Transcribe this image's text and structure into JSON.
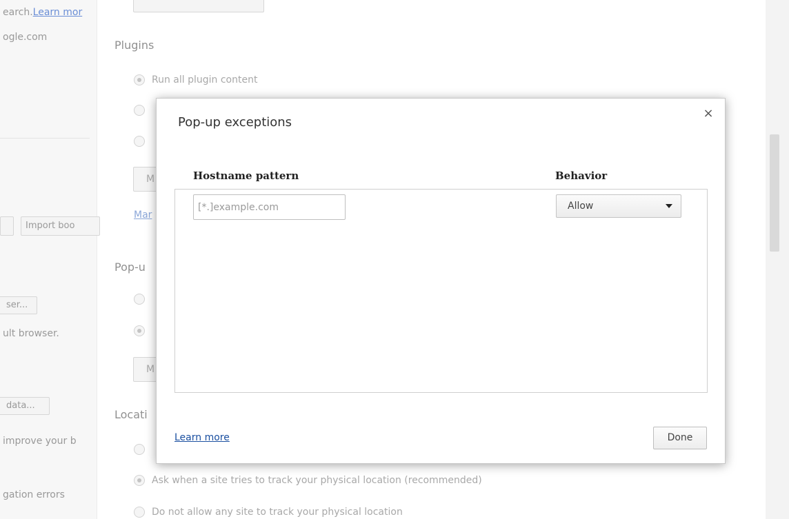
{
  "background": {
    "left_panel": {
      "t1": "earch.",
      "t1_link": "Learn mor",
      "t2": "ogle.com",
      "import_button": "Import boo",
      "btn2": "ser...",
      "t3": "ult browser.",
      "data_button": "data...",
      "t4": "improve your b",
      "t5": "gation errors"
    },
    "plugins": {
      "title": "Plugins",
      "option_run_all": "Run all plugin content",
      "button_partial": "M",
      "link_partial": "Mar"
    },
    "popups": {
      "title": "Pop-u",
      "button_partial": "M"
    },
    "location": {
      "title": "Locati",
      "option_ask": "Ask when a site tries to track your physical location (recommended)",
      "option_deny": "Do not allow any site to track your physical location"
    }
  },
  "dialog": {
    "title": "Pop-up exceptions",
    "close_symbol": "×",
    "columns": {
      "hostname": "Hostname pattern",
      "behavior": "Behavior"
    },
    "new_row": {
      "hostname_placeholder": "[*.]example.com",
      "hostname_value": "",
      "behavior_value": "Allow"
    },
    "learn_more_label": "Learn more",
    "done_label": "Done"
  }
}
